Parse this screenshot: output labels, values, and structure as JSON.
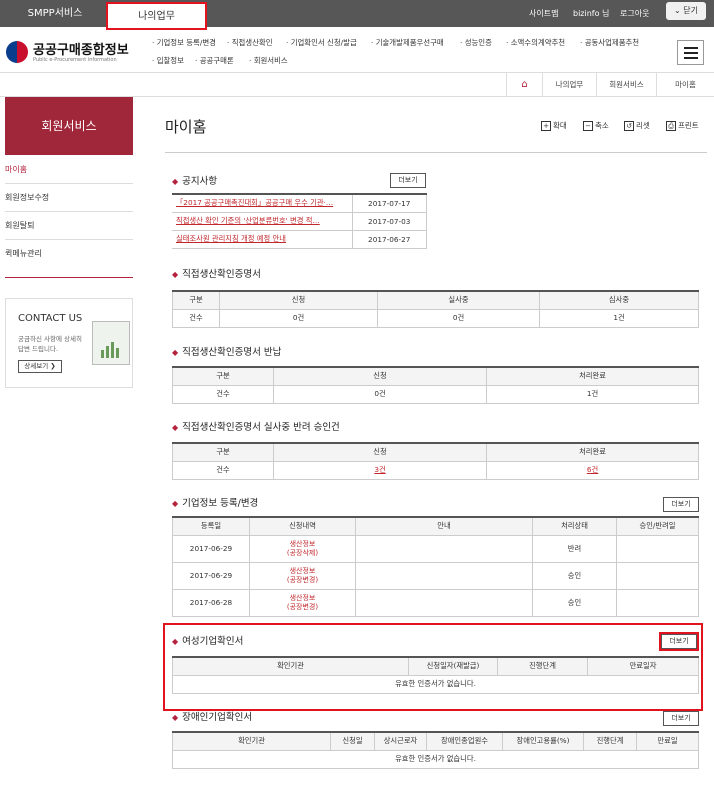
{
  "topbar": {
    "tab_smpp": "SMPP서비스",
    "tab_my": "나의업무",
    "link_sitemap": "사이트맵",
    "user": "bizinfo 님",
    "logout": "로그아웃",
    "close": "닫기"
  },
  "logo": {
    "title": "공공구매종합정보",
    "subtitle": "Public e-Procurement information"
  },
  "gnav": [
    "기업정보 등록/변경",
    "직접생산확인",
    "기업확인서 신청/발급",
    "기술개발제품우선구매",
    "성능인증",
    "소액수의계약추천",
    "공동사업제품추천",
    "입찰정보",
    "공공구매론",
    "회원서비스"
  ],
  "breadcrumb": {
    "home": "⌂",
    "items": [
      "나의업무",
      "회원서비스",
      "마이홈"
    ]
  },
  "side": {
    "banner": "회원서비스",
    "items": [
      "마이홈",
      "회원정보수정",
      "회원탈퇴",
      "퀵메뉴관리"
    ],
    "contact_title": "CONTACT US",
    "contact_desc1": "궁금하신 사항에 상세히",
    "contact_desc2": "답변 드립니다.",
    "contact_btn": "상세보기 ❯"
  },
  "page": {
    "title": "마이홈",
    "tools": [
      "확대",
      "축소",
      "리셋",
      "프린트"
    ]
  },
  "more": "더보기",
  "notice": {
    "title": "공지사항",
    "rows": [
      {
        "text": "「2017 공공구매촉진대회」공공구매 우수 기관·…",
        "date": "2017-07-17"
      },
      {
        "text": "직접생산 확인 기준의 '산업분류번호' 변경 적…",
        "date": "2017-07-03"
      },
      {
        "text": "실태조사원 관리지침 개정 예정 안내",
        "date": "2017-06-27"
      }
    ]
  },
  "cert": {
    "title": "직접생산확인증명서",
    "headers": [
      "구분",
      "신청",
      "실사중",
      "심사중"
    ],
    "row": [
      "건수",
      "0건",
      "0건",
      "1건"
    ]
  },
  "return": {
    "title": "직접생산확인증명서 반납",
    "headers": [
      "구분",
      "신청",
      "처리완료"
    ],
    "row": [
      "건수",
      "0건",
      "1건"
    ]
  },
  "reject": {
    "title": "직접생산확인증명서 실사중 반려 승인건",
    "headers": [
      "구분",
      "신청",
      "처리완료"
    ],
    "row": [
      "건수",
      "3건",
      "6건"
    ]
  },
  "company": {
    "title": "기업정보 등록/변경",
    "headers": [
      "등록일",
      "신청내역",
      "안내",
      "처리상태",
      "승인/반려일"
    ],
    "rows": [
      {
        "date": "2017-06-29",
        "item1": "생산정보",
        "item2": "(공장삭제)",
        "status": "반려"
      },
      {
        "date": "2017-06-29",
        "item1": "생산정보",
        "item2": "(공장변경)",
        "status": "승인"
      },
      {
        "date": "2017-06-28",
        "item1": "생산정보",
        "item2": "(공장변경)",
        "status": "승인"
      }
    ]
  },
  "women": {
    "title": "여성기업확인서",
    "headers": [
      "확인기관",
      "신청일자(재발급)",
      "진행단계",
      "만료일자"
    ],
    "empty": "유효한 인증서가 없습니다."
  },
  "disabled": {
    "title": "장애인기업확인서",
    "headers": [
      "확인기관",
      "신청일",
      "상시근로자",
      "장애인종업원수",
      "장애인고용률(%)",
      "진행단계",
      "만료일"
    ],
    "empty": "유효한 인증서가 없습니다."
  }
}
